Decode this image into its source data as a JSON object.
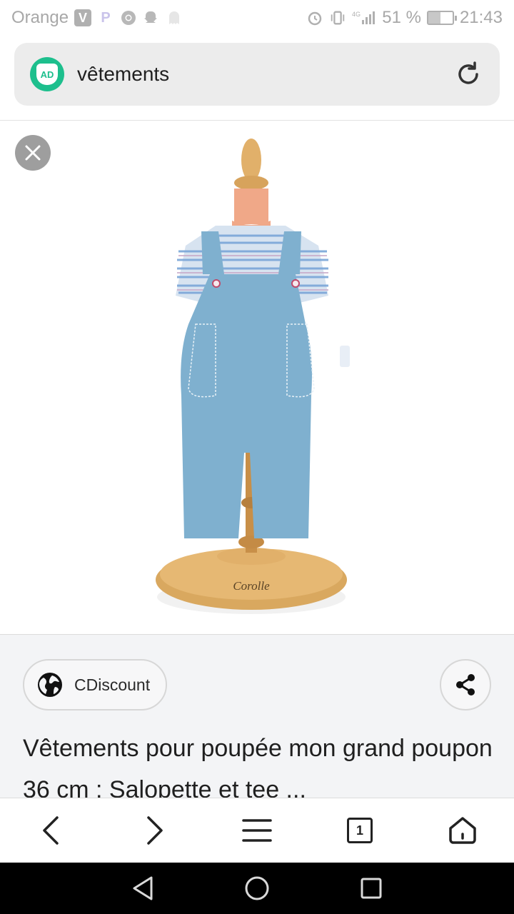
{
  "status_bar": {
    "carrier": "Orange",
    "network": "4G",
    "battery_percent": "51 %",
    "battery_level": 0.51,
    "time": "21:43"
  },
  "search": {
    "query": "vêtements",
    "ad_badge": "AD"
  },
  "image": {
    "brand_text": "Corolle"
  },
  "result": {
    "source": "CDiscount",
    "title": "Vêtements pour poupée mon grand poupon 36 cm : Salopette et tee ..."
  },
  "browser_nav": {
    "tab_count": "1"
  },
  "icons": {
    "reload": "reload-icon",
    "close": "close-icon",
    "globe": "globe-icon",
    "share": "share-icon",
    "back": "back-arrow-icon",
    "forward": "forward-arrow-icon",
    "menu": "menu-icon",
    "tabs": "tabs-icon",
    "home": "home-icon"
  },
  "colors": {
    "ad_green": "#1dbf8d",
    "panel_bg": "#f3f4f6",
    "denim": "#7fb0cf"
  }
}
